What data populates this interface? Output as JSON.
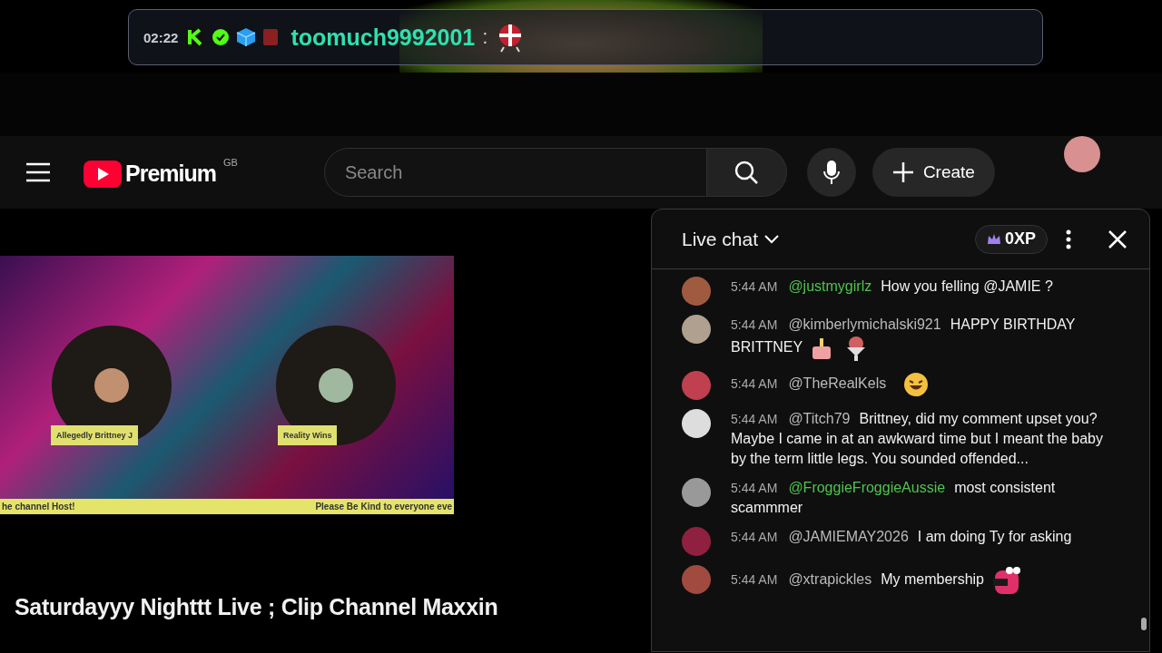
{
  "overlay": {
    "time": "02:22",
    "username": "toomuch9992001",
    "separator": ":"
  },
  "header": {
    "logo_text": "Premium",
    "region": "GB",
    "search": {
      "placeholder": "Search"
    },
    "create_label": "Create"
  },
  "video": {
    "participants": [
      {
        "name": "Allegedly Brittney J"
      },
      {
        "name": "Reality Wins"
      }
    ],
    "ticker": [
      "he channel Host!",
      "Please Be Kind to everyone eve"
    ],
    "title": "Saturdayyy Nighttt Live ; Clip Channel Maxxin"
  },
  "chat": {
    "title": "Live chat",
    "xp": "0XP",
    "messages": [
      {
        "time": "5:44 AM",
        "author": "@justmygirlz",
        "member": true,
        "text": "How you felling @JAMIE ?"
      },
      {
        "time": "5:44 AM",
        "author": "@kimberlymichalski921",
        "member": false,
        "text": "HAPPY BIRTHDAY BRITTNEY",
        "stickers": [
          {
            "kind": "cake"
          },
          {
            "kind": "sundae"
          }
        ]
      },
      {
        "time": "5:44 AM",
        "author": "@TheRealKels",
        "member": false,
        "stickers": [
          {
            "kind": "laugh"
          }
        ]
      },
      {
        "time": "5:44 AM",
        "author": "@Titch79",
        "member": false,
        "text": "Brittney, did my comment upset you? Maybe I came in at an awkward time but I meant the baby by the term little legs. You sounded offended..."
      },
      {
        "time": "5:44 AM",
        "author": "@FroggieFroggieAussie",
        "member": true,
        "text": "most consistent scammmer"
      },
      {
        "time": "5:44 AM",
        "author": "@JAMIEMAY2026",
        "member": false,
        "text": "I am doing Ty for asking"
      },
      {
        "time": "5:44 AM",
        "author": "@xtrapickles",
        "member": false,
        "text": "My membership",
        "stickers": [
          {
            "kind": "monster"
          }
        ]
      }
    ]
  }
}
